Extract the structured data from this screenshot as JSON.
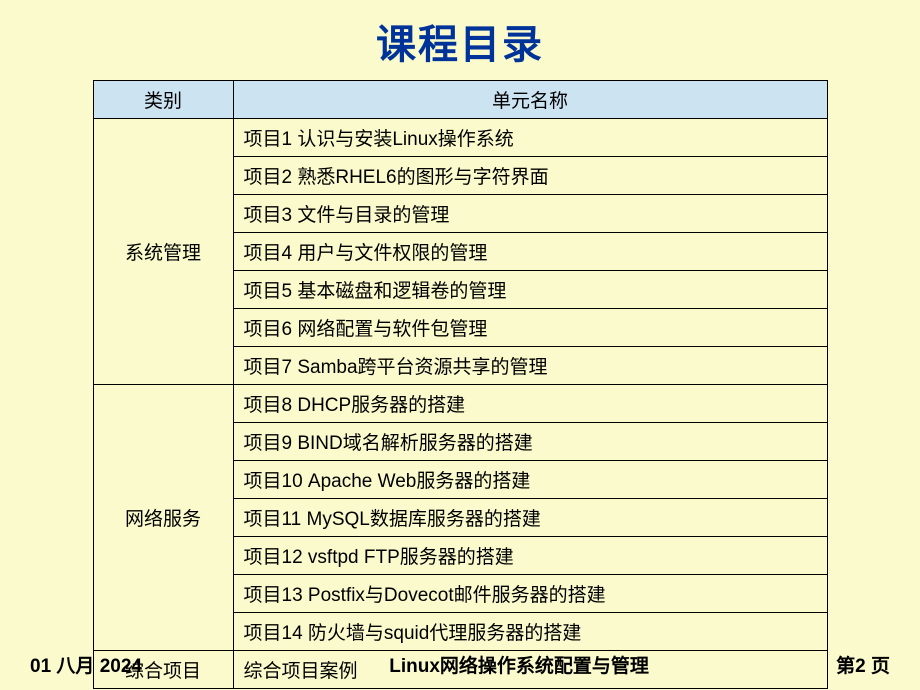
{
  "title": "课程目录",
  "headers": {
    "category": "类别",
    "unit_name": "单元名称"
  },
  "sections": [
    {
      "category": "系统管理",
      "items": [
        "项目1  认识与安装Linux操作系统",
        "项目2  熟悉RHEL6的图形与字符界面",
        "项目3  文件与目录的管理",
        "项目4  用户与文件权限的管理",
        "项目5  基本磁盘和逻辑卷的管理",
        "项目6  网络配置与软件包管理",
        "项目7  Samba跨平台资源共享的管理"
      ]
    },
    {
      "category": "网络服务",
      "items": [
        "项目8  DHCP服务器的搭建",
        "项目9  BIND域名解析服务器的搭建",
        "项目10 Apache Web服务器的搭建",
        "项目11 MySQL数据库服务器的搭建",
        "项目12 vsftpd FTP服务器的搭建",
        "项目13 Postfix与Dovecot邮件服务器的搭建",
        "项目14 防火墙与squid代理服务器的搭建"
      ]
    },
    {
      "category": "综合项目",
      "items": [
        "综合项目案例"
      ]
    }
  ],
  "footer": {
    "date": "01 八月 2024",
    "center": "Linux网络操作系统配置与管理",
    "page": "第2 页"
  }
}
